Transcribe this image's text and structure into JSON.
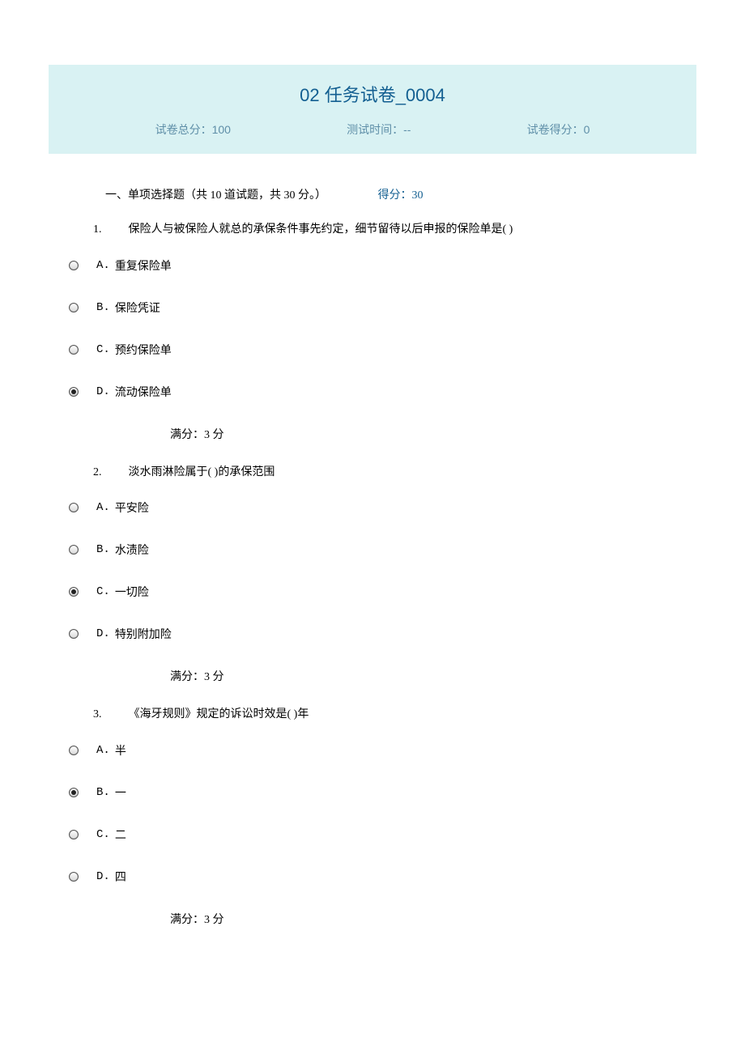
{
  "header": {
    "title": "02 任务试卷_0004",
    "totalLabel": "试卷总分：100",
    "timeLabel": "测试时间：--",
    "scoreLabel": "试卷得分：0"
  },
  "section": {
    "title": "一、单项选择题（共  10  道试题，共  30  分。）",
    "scoreLabel": "得分：30"
  },
  "questions": [
    {
      "num": "1.",
      "text": "保险人与被保险人就总的承保条件事先约定，细节留待以后申报的保险单是(  )",
      "options": [
        {
          "letter": "A.",
          "text": "重复保险单",
          "selected": false
        },
        {
          "letter": "B.",
          "text": "保险凭证",
          "selected": false
        },
        {
          "letter": "C.",
          "text": "预约保险单",
          "selected": false
        },
        {
          "letter": "D.",
          "text": "流动保险单",
          "selected": true
        }
      ],
      "scoreLabel": "满分：3    分"
    },
    {
      "num": "2.",
      "text": "淡水雨淋险属于(  )的承保范围",
      "options": [
        {
          "letter": "A.",
          "text": "平安险",
          "selected": false
        },
        {
          "letter": "B.",
          "text": "水渍险",
          "selected": false
        },
        {
          "letter": "C.",
          "text": "一切险",
          "selected": true
        },
        {
          "letter": "D.",
          "text": "特别附加险",
          "selected": false
        }
      ],
      "scoreLabel": "满分：3    分"
    },
    {
      "num": "3.",
      "text": "《海牙规则》规定的诉讼时效是(  )年",
      "options": [
        {
          "letter": "A.",
          "text": "半",
          "selected": false
        },
        {
          "letter": "B.",
          "text": "一",
          "selected": true
        },
        {
          "letter": "C.",
          "text": "二",
          "selected": false
        },
        {
          "letter": "D.",
          "text": "四",
          "selected": false
        }
      ],
      "scoreLabel": "满分：3    分"
    }
  ]
}
